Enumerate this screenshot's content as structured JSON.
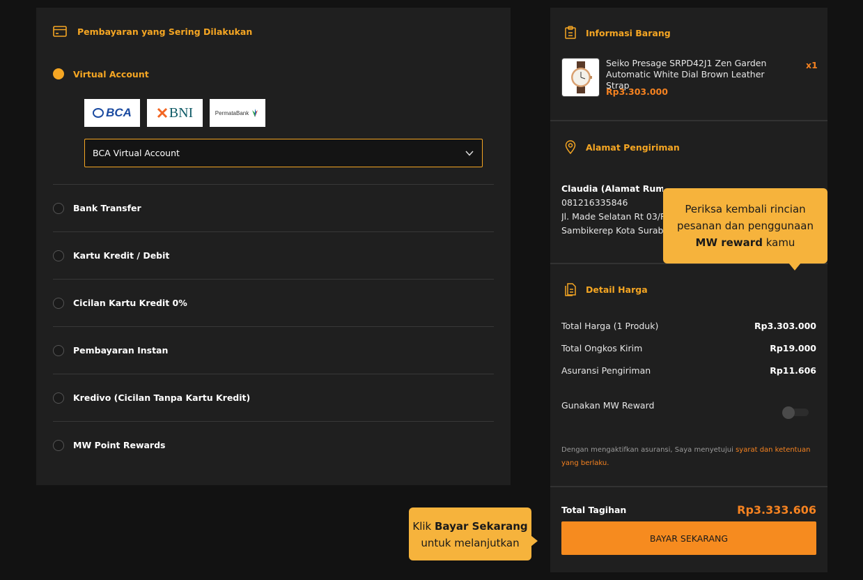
{
  "payment": {
    "header_title": "Pembayaran yang Sering Dilakukan",
    "selected_method": "Virtual Account",
    "banks": [
      {
        "name": "BCA"
      },
      {
        "name": "BNI"
      },
      {
        "name": "PermataBank"
      }
    ],
    "selected_bank": "BCA Virtual Account",
    "methods": [
      {
        "label": "Bank Transfer"
      },
      {
        "label": "Kartu Kredit / Debit"
      },
      {
        "label": "Cicilan Kartu Kredit 0%"
      },
      {
        "label": "Pembayaran Instan"
      },
      {
        "label": "Kredivo (Cicilan Tanpa Kartu Kredit)"
      },
      {
        "label": "MW Point Rewards"
      }
    ]
  },
  "item_info": {
    "title": "Informasi Barang",
    "product_name": "Seiko Presage SRPD42J1 Zen Garden Automatic White Dial Brown Leather Strap",
    "product_price": "Rp3.303.000",
    "quantity": "x1"
  },
  "shipping": {
    "title": "Alamat Pengiriman",
    "recipient": "Claudia (Alamat Rumah)",
    "phone": "081216335846",
    "address_line1": "Jl. Made Selatan Rt 03/RW",
    "address_line2": "Sambikerep Kota Surabaya"
  },
  "price_detail": {
    "title": "Detail Harga",
    "rows": [
      {
        "label": "Total Harga (1 Produk)",
        "value": "Rp3.303.000"
      },
      {
        "label": "Total Ongkos Kirim",
        "value": "Rp19.000"
      },
      {
        "label": "Asuransi Pengiriman",
        "value": "Rp11.606"
      }
    ],
    "reward_label": "Gunakan MW Reward",
    "reward_enabled": false,
    "terms_text": "Dengan mengaktifkan asuransi, Saya menyetujui ",
    "terms_link": "syarat dan ketentuan yang berlaku."
  },
  "checkout": {
    "total_label": "Total Tagihan",
    "total_value": "Rp3.333.606",
    "pay_button": "BAYAR SEKARANG"
  },
  "tooltips": {
    "review_line1": "Periksa kembali rincian",
    "review_line2": "pesanan dan penggunaan",
    "review_bold": "MW reward",
    "review_tail": " kamu",
    "pay_prefix": "Klik ",
    "pay_bold": "Bayar Sekarang",
    "pay_line2": "untuk melanjutkan"
  },
  "colors": {
    "accent_orange": "#f58220",
    "accent_yellow": "#f5a623",
    "tooltip_bg": "#f6b33c",
    "panel_bg": "#1f1f1f",
    "page_bg": "#121212"
  }
}
